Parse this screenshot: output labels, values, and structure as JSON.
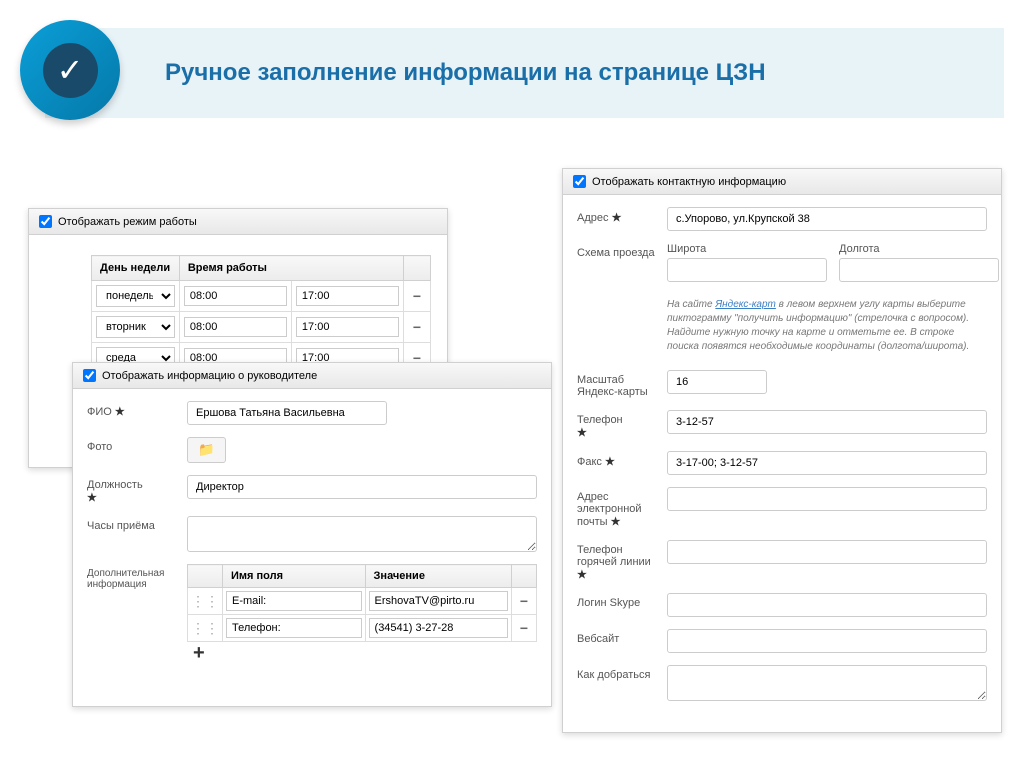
{
  "page": {
    "title": "Ручное заполнение информации на странице ЦЗН"
  },
  "schedule": {
    "checkbox_label": "Отображать режим работы",
    "col_day": "День недели",
    "col_time": "Время работы",
    "rows": [
      {
        "day": "понедельник",
        "from": "08:00",
        "to": "17:00"
      },
      {
        "day": "вторник",
        "from": "08:00",
        "to": "17:00"
      },
      {
        "day": "среда",
        "from": "08:00",
        "to": "17:00"
      }
    ]
  },
  "manager": {
    "checkbox_label": "Отображать информацию о руководителе",
    "fio_label": "ФИО",
    "fio_value": "Ершова Татьяна Васильевна",
    "photo_label": "Фото",
    "position_label": "Должность",
    "position_value": "Директор",
    "hours_label": "Часы приёма",
    "hours_value": "",
    "extra_label": "Дополнительная информация",
    "col_field": "Имя поля",
    "col_value": "Значение",
    "extras": [
      {
        "field": "E-mail:",
        "value": "ErshovaTV@pirto.ru"
      },
      {
        "field": "Телефон:",
        "value": "(34541) 3-27-28"
      }
    ]
  },
  "contact": {
    "checkbox_label": "Отображать контактную информацию",
    "address_label": "Адрес",
    "address_value": "с.Упорово, ул.Крупской 38",
    "route_label": "Схема проезда",
    "lat_label": "Широта",
    "lng_label": "Долгота",
    "lat_value": "",
    "lng_value": "",
    "hint_prefix": "На сайте ",
    "hint_link": "Яндекс-карт",
    "hint_rest": " в левом верхнем углу карты выберите пиктограмму \"получить информацию\" (стрелочка с вопросом). Найдите нужную точку на карте и отметьте ее. В строке поиска появятся необходимые координаты (долгота/широта).",
    "zoom_label": "Масштаб Яндекс-карты",
    "zoom_value": "16",
    "phone_label": "Телефон",
    "phone_value": "3-12-57",
    "fax_label": "Факс",
    "fax_value": "3-17-00; 3-12-57",
    "email_label": "Адрес электронной почты",
    "hotline_label": "Телефон горячей линии",
    "skype_label": "Логин Skype",
    "website_label": "Вебсайт",
    "directions_label": "Как добраться"
  }
}
